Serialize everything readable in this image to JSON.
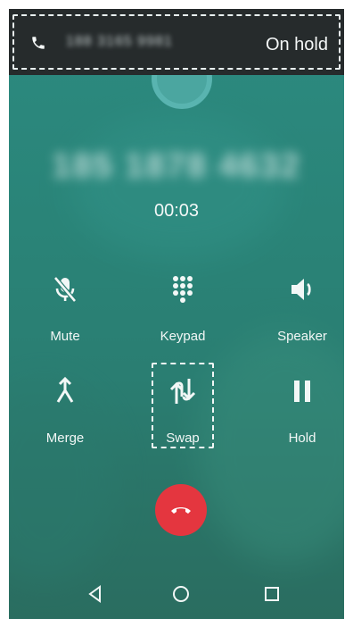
{
  "hold_bar": {
    "icon": "phone-icon",
    "number": "188 3165 9981",
    "status": "On hold"
  },
  "call": {
    "number": "185 1878 4632",
    "timer": "00:03"
  },
  "controls": [
    {
      "label": "Mute",
      "icon": "mute-icon"
    },
    {
      "label": "Keypad",
      "icon": "keypad-icon"
    },
    {
      "label": "Speaker",
      "icon": "speaker-icon"
    },
    {
      "label": "Merge",
      "icon": "merge-icon"
    },
    {
      "label": "Swap",
      "icon": "swap-icon"
    },
    {
      "label": "Hold",
      "icon": "pause-icon"
    }
  ],
  "end_call": {
    "icon": "end-call-icon",
    "color": "#e4363f"
  },
  "navigation": {
    "back_icon": "back-triangle-icon",
    "home_icon": "home-circle-icon",
    "recents_icon": "recents-square-icon"
  },
  "colors": {
    "background": "#2a7e72",
    "hold_bar": "#262b2c",
    "end_call": "#e4363f",
    "text": "#f2f7f6"
  }
}
